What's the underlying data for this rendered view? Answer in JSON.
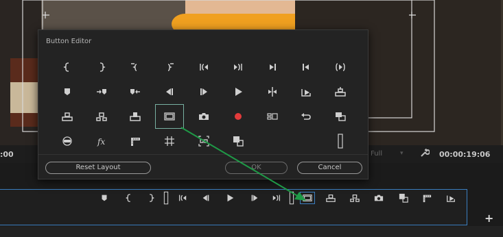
{
  "dialog": {
    "title": "Button Editor",
    "reset_label": "Reset Layout",
    "ok_label": "OK",
    "cancel_label": "Cancel",
    "selected_index": 21,
    "icons": [
      "mark-in-icon",
      "mark-out-icon",
      "clear-in-icon",
      "clear-out-icon",
      "go-to-in-icon",
      "go-to-out-icon",
      "go-to-out-alt-icon",
      "go-to-in-alt-icon",
      "play-in-to-out-icon",
      "add-marker-icon",
      "go-to-next-marker-icon",
      "go-to-previous-marker-icon",
      "step-back-icon",
      "step-forward-icon",
      "play-stop-icon",
      "shuttle-icon",
      "export-icon",
      "insert-icon",
      "lift-icon",
      "extract-icon",
      "overwrite-icon",
      "safe-margins-icon",
      "export-frame-icon",
      "record-icon",
      "multicam-icon",
      "loop-icon",
      "trim-icon",
      "vr-video-icon",
      "fx-icon",
      "filmstrip-icon",
      "grid-icon",
      "comparison-icon",
      "proxy-icon",
      "spacer-icon",
      "spacer-icon",
      "spacer-bar-icon"
    ]
  },
  "timeline": {
    "left_timecode": ":00",
    "timecode": "00:00:19:06",
    "resolution": "Full"
  },
  "transport_bar": {
    "icons": [
      "add-marker-icon",
      "mark-in-icon",
      "mark-out-icon",
      "spacer-bar-icon",
      "go-to-in-icon",
      "step-back-icon",
      "play-stop-icon",
      "step-forward-icon",
      "go-to-out-icon",
      "spacer-bar-icon",
      "safe-margins-icon",
      "lift-icon",
      "extract-icon",
      "export-frame-icon",
      "proxy-icon",
      "filmstrip-icon",
      "export-icon"
    ],
    "add_label": "+"
  },
  "colors": {
    "accent_green": "#1f9a47",
    "selection": "#79b2a3",
    "bar_border": "#3b7fc1",
    "record": "#e23b3b"
  }
}
